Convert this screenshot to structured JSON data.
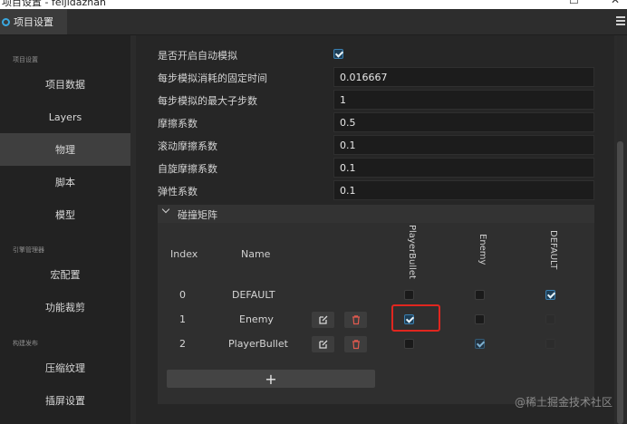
{
  "window": {
    "title": "项目设置 - feijidazhan",
    "min_glyph": "–",
    "max_glyph": "☐",
    "close_glyph": "✕"
  },
  "tab": {
    "label": "项目设置"
  },
  "sidebar": {
    "groups": [
      {
        "label": "项目设置",
        "items": [
          "项目数据",
          "Layers",
          "物理",
          "脚本",
          "模型"
        ]
      },
      {
        "label": "引擎管理器",
        "items": [
          "宏配置",
          "功能裁剪"
        ]
      },
      {
        "label": "构建发布",
        "items": [
          "压缩纹理",
          "插屏设置"
        ]
      }
    ],
    "active": "物理"
  },
  "physics": {
    "auto_simulation": {
      "label": "是否开启自动模拟",
      "checked": true
    },
    "fixed_time_step": {
      "label": "每步模拟消耗的固定时间",
      "value": "0.016667"
    },
    "max_sub_steps": {
      "label": "每步模拟的最大子步数",
      "value": "1"
    },
    "friction": {
      "label": "摩擦系数",
      "value": "0.5"
    },
    "rolling_friction": {
      "label": "滚动摩擦系数",
      "value": "0.1"
    },
    "spinning_friction": {
      "label": "自旋摩擦系数",
      "value": "0.1"
    },
    "restitution": {
      "label": "弹性系数",
      "value": "0.1"
    }
  },
  "collision_matrix": {
    "title": "碰撞矩阵",
    "headers": {
      "index": "Index",
      "name": "Name"
    },
    "columns": [
      "PlayerBullet",
      "Enemy",
      "DEFAULT"
    ],
    "rows": [
      {
        "index": "0",
        "name": "DEFAULT",
        "editable": false,
        "cells": [
          "off",
          "off",
          "on"
        ]
      },
      {
        "index": "1",
        "name": "Enemy",
        "editable": true,
        "cells": [
          "on",
          "off",
          "disabled"
        ]
      },
      {
        "index": "2",
        "name": "PlayerBullet",
        "editable": true,
        "cells": [
          "off",
          "on-dim",
          "disabled"
        ]
      }
    ],
    "add_label": "+"
  },
  "icons": {
    "edit": "edit-icon",
    "delete": "trash-icon",
    "tab": "gear-icon",
    "menu": "hamburger-icon"
  },
  "colors": {
    "accent": "#3a7fb0",
    "highlight": "#e0261f",
    "delete": "#e05a4f"
  },
  "watermark": "@稀土掘金技术社区"
}
